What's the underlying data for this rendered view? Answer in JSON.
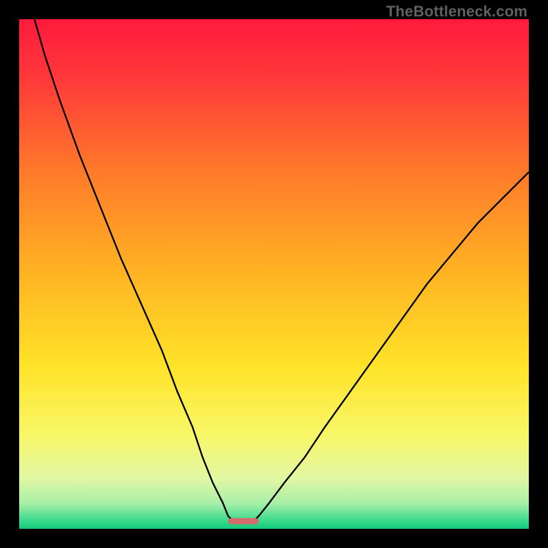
{
  "watermark": "TheBottleneck.com",
  "chart_data": {
    "type": "line",
    "title": "",
    "xlabel": "",
    "ylabel": "",
    "xlim": [
      0,
      100
    ],
    "ylim": [
      0,
      100
    ],
    "curve_left": {
      "comment": "Left descending curve, starts near top-left and drops to the minimum near x≈42",
      "x": [
        3,
        5,
        8,
        12,
        16,
        20,
        24,
        28,
        31,
        34,
        36,
        38,
        40,
        41,
        42
      ],
      "y": [
        100,
        93,
        84,
        73,
        63,
        53,
        44,
        35,
        27,
        20,
        14,
        9,
        5,
        2.5,
        1.5
      ]
    },
    "curve_right": {
      "comment": "Right ascending curve, rises from the minimum near x≈46 toward the right edge",
      "x": [
        46,
        47,
        49,
        52,
        56,
        60,
        65,
        70,
        75,
        80,
        85,
        90,
        95,
        100
      ],
      "y": [
        1.5,
        2.5,
        5,
        9,
        14,
        20,
        27,
        34,
        41,
        48,
        54,
        60,
        65,
        70
      ]
    },
    "minimum_marker": {
      "comment": "Short red horizontal bar marking the minimum region at the bottom",
      "x_range": [
        41,
        47
      ],
      "y": 1.5,
      "color": "#d66a6a"
    },
    "background_gradient": {
      "comment": "Vertical gradient from red (top) through orange/yellow to green (bottom)",
      "stops": [
        {
          "offset": 0.0,
          "color": "#ff1a3d"
        },
        {
          "offset": 0.12,
          "color": "#ff3a3a"
        },
        {
          "offset": 0.3,
          "color": "#ff7a2a"
        },
        {
          "offset": 0.5,
          "color": "#ffb423"
        },
        {
          "offset": 0.68,
          "color": "#ffe328"
        },
        {
          "offset": 0.82,
          "color": "#f7f76a"
        },
        {
          "offset": 0.9,
          "color": "#e2f7a3"
        },
        {
          "offset": 0.95,
          "color": "#a8eFa8"
        },
        {
          "offset": 0.985,
          "color": "#37d98b"
        },
        {
          "offset": 1.0,
          "color": "#14c77a"
        }
      ]
    }
  }
}
